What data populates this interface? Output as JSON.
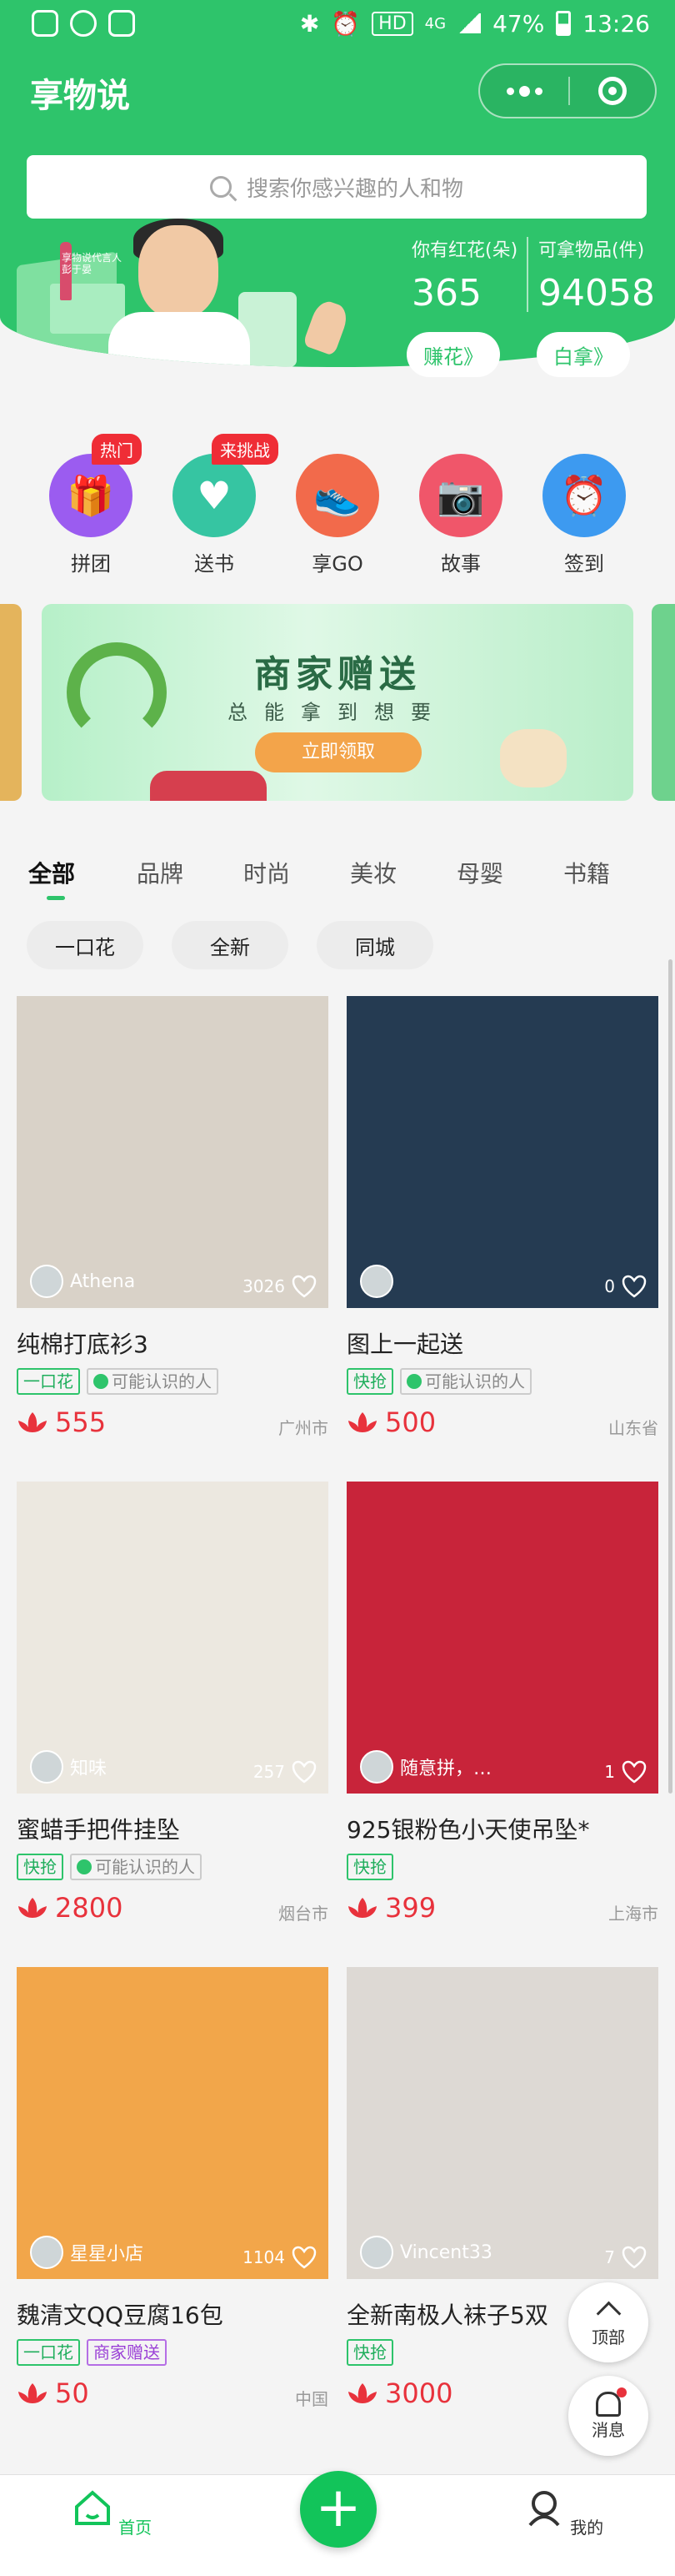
{
  "status_bar": {
    "hd": "HD",
    "network": "4G",
    "battery": "47%",
    "time": "13:26"
  },
  "header": {
    "title": "享物说"
  },
  "search": {
    "placeholder": "搜索你感兴趣的人和物"
  },
  "hero": {
    "caption": "享物说代言人 彭于晏",
    "stats": [
      {
        "label": "你有红花(朵)",
        "value": "365",
        "button": "赚花》"
      },
      {
        "label": "可拿物品(件)",
        "value": "94058",
        "button": "白拿》"
      }
    ]
  },
  "categories": [
    {
      "label": "拼团",
      "badge": "热门",
      "color": "#9b5cf0",
      "icon": "gift-icon"
    },
    {
      "label": "送书",
      "badge": "来挑战",
      "color": "#36c5a2",
      "icon": "heart-hands-icon"
    },
    {
      "label": "享GO",
      "badge": "",
      "color": "#f26a4b",
      "icon": "sneaker-icon"
    },
    {
      "label": "故事",
      "badge": "",
      "color": "#f0566a",
      "icon": "camera-icon"
    },
    {
      "label": "签到",
      "badge": "",
      "color": "#3d9af0",
      "icon": "alarm-clock-icon"
    }
  ],
  "banner": {
    "title": "商家赠送",
    "subtitle": "总能拿到想要",
    "button": "立即领取"
  },
  "tabs": [
    "全部",
    "品牌",
    "时尚",
    "美妆",
    "母婴",
    "书籍"
  ],
  "filters": [
    "一口花",
    "全新",
    "同城"
  ],
  "products": [
    {
      "title": "纯棉打底衫3",
      "owner": "Athena",
      "likes": "3026",
      "tags": [
        {
          "text": "一口花",
          "style": "green"
        },
        {
          "text": "可能认识的人",
          "style": "gray"
        }
      ],
      "price": "555",
      "location": "广州市",
      "bg": "#d9d2c8"
    },
    {
      "title": "图上一起送",
      "owner": "",
      "likes": "0",
      "tags": [
        {
          "text": "快抢",
          "style": "green"
        },
        {
          "text": "可能认识的人",
          "style": "gray"
        }
      ],
      "price": "500",
      "location": "山东省",
      "bg": "#253b52"
    },
    {
      "title": "蜜蜡手把件挂坠",
      "owner": "知味",
      "likes": "257",
      "tags": [
        {
          "text": "快抢",
          "style": "green"
        },
        {
          "text": "可能认识的人",
          "style": "gray"
        }
      ],
      "price": "2800",
      "location": "烟台市",
      "bg": "#ece8e0"
    },
    {
      "title": "925银粉色小天使吊坠*",
      "owner": "随意拼，…",
      "likes": "1",
      "tags": [
        {
          "text": "快抢",
          "style": "green"
        }
      ],
      "price": "399",
      "location": "上海市",
      "bg": "#c8243a"
    },
    {
      "title": "魏清文QQ豆腐16包",
      "owner": "星星小店",
      "likes": "1104",
      "tags": [
        {
          "text": "一口花",
          "style": "green"
        },
        {
          "text": "商家赠送",
          "style": "purple"
        }
      ],
      "price": "50",
      "location": "中国",
      "bg": "#f2a64a"
    },
    {
      "title": "全新南极人袜子5双",
      "owner": "Vincent33",
      "likes": "7",
      "tags": [
        {
          "text": "快抢",
          "style": "green"
        }
      ],
      "price": "3000",
      "location": "",
      "bg": "#ddd9d4"
    }
  ],
  "float": {
    "top_label": "顶部",
    "msg_label": "消息"
  },
  "bottom_nav": {
    "home": "首页",
    "me": "我的",
    "fab": "+"
  },
  "colors": {
    "brand": "#2ec46b",
    "price": "#e8323c"
  }
}
